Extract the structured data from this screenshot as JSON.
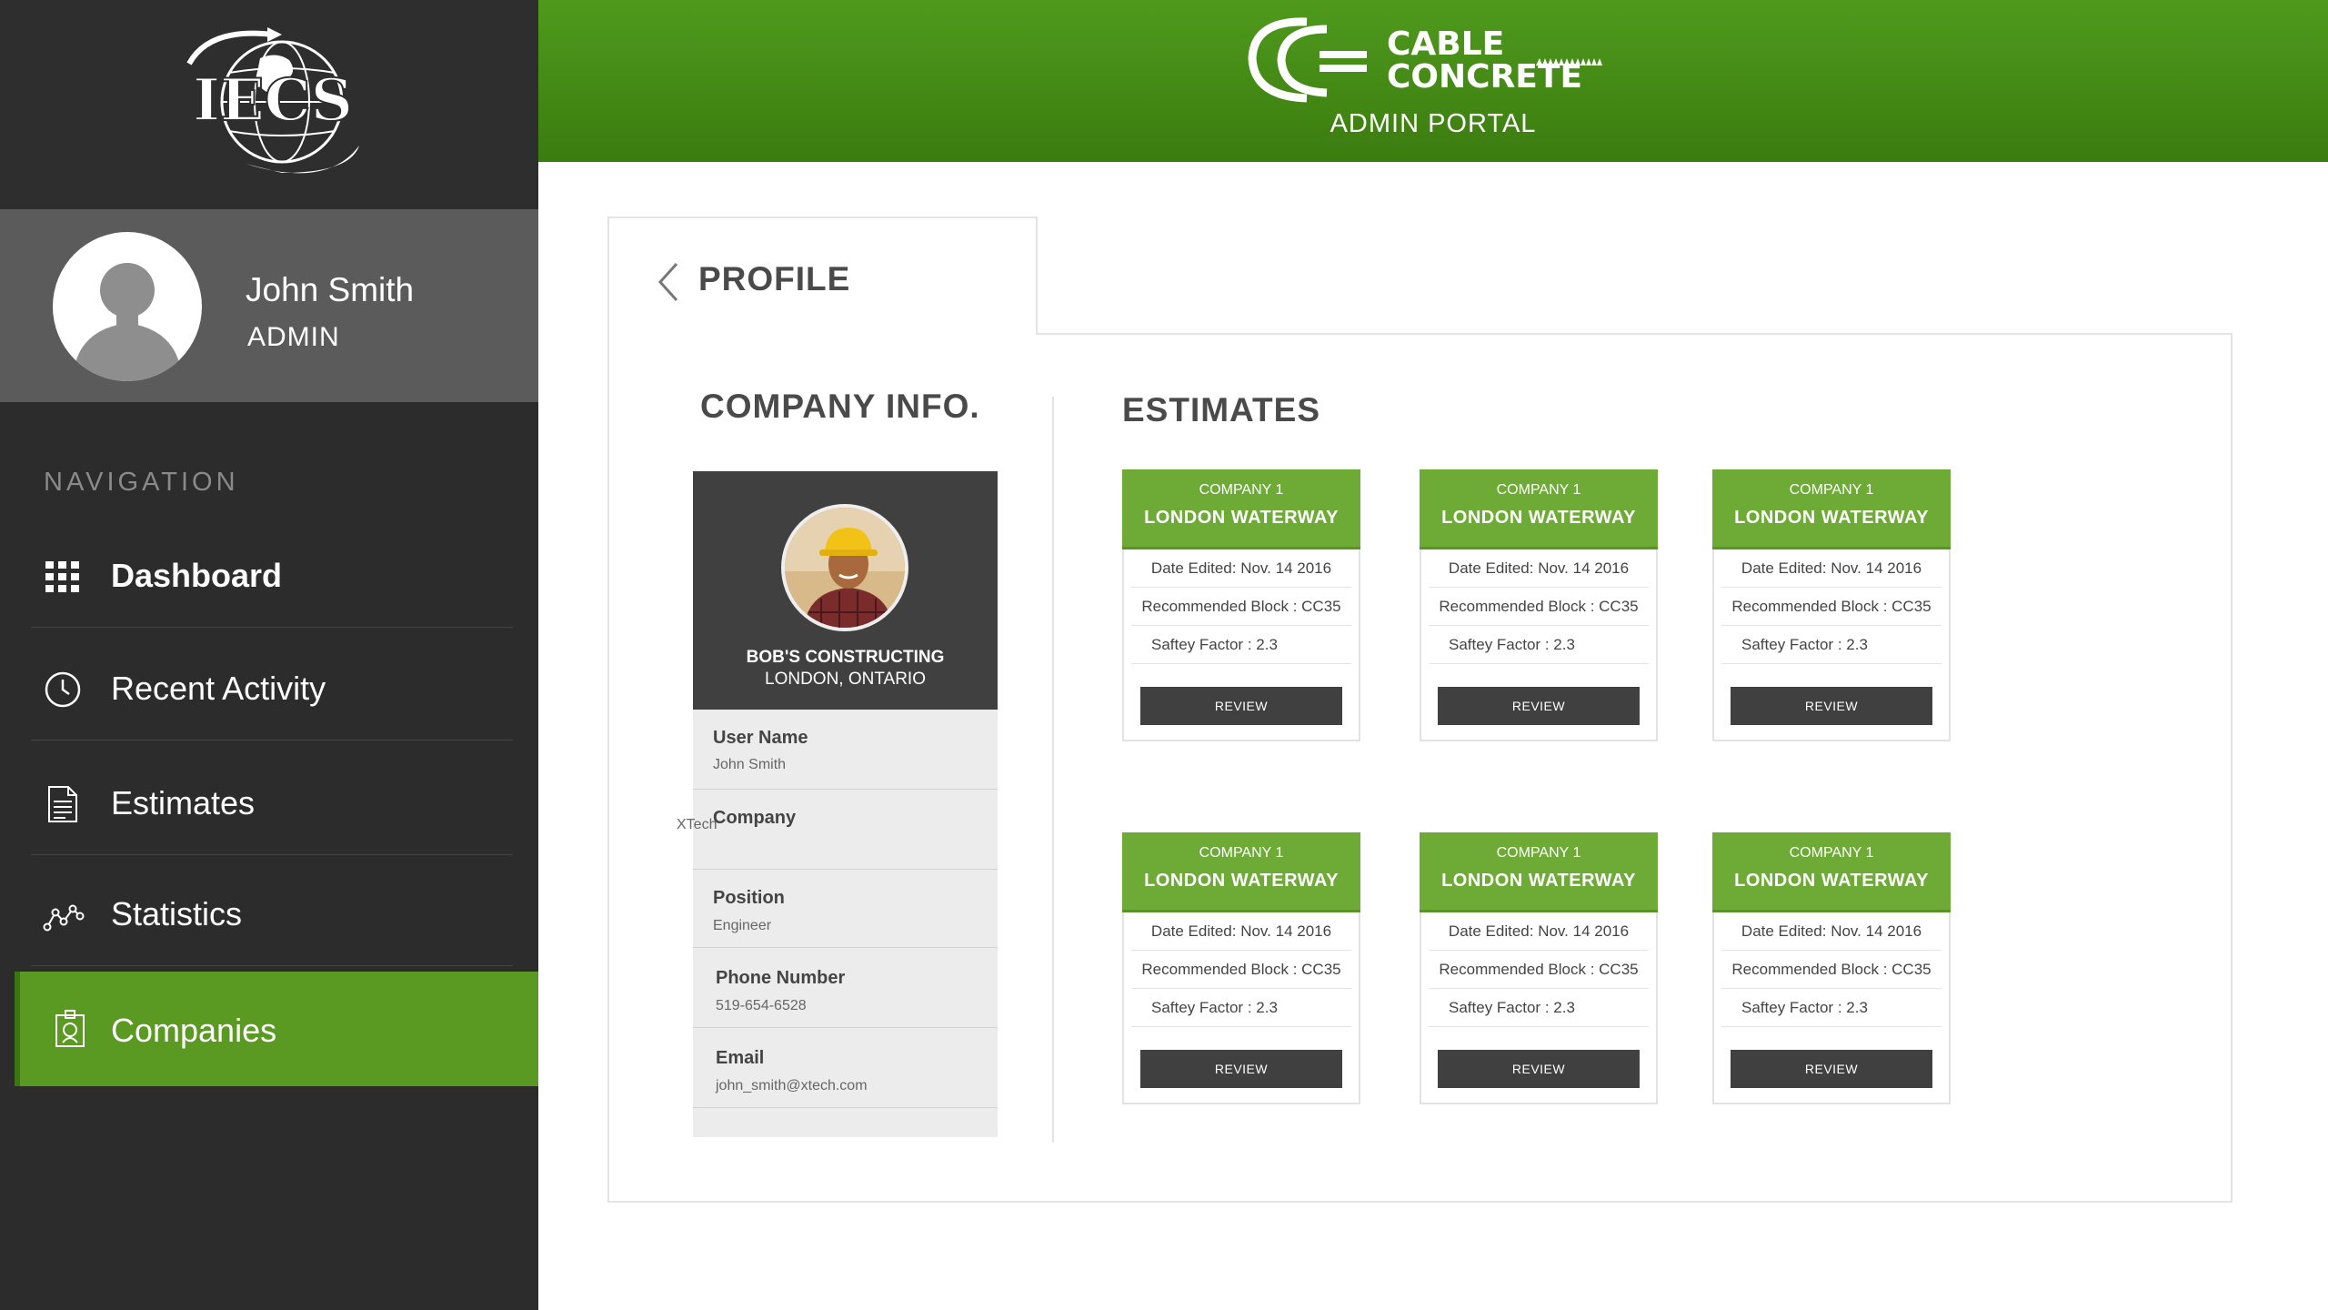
{
  "sidebar": {
    "logo_text": "IECS",
    "user": {
      "name": "John Smith",
      "role": "ADMIN"
    },
    "nav_heading": "NAVIGATION",
    "items": [
      {
        "label": "Dashboard",
        "icon": "grid-icon",
        "active": false
      },
      {
        "label": "Recent Activity",
        "icon": "clock-icon",
        "active": false
      },
      {
        "label": "Estimates",
        "icon": "document-icon",
        "active": false
      },
      {
        "label": "Statistics",
        "icon": "line-graph-icon",
        "active": false
      },
      {
        "label": "Companies",
        "icon": "id-badge-icon",
        "active": true
      }
    ]
  },
  "header": {
    "logo_line1": "CABLE",
    "logo_line2": "CONCRETE",
    "portal_title": "ADMIN PORTAL"
  },
  "profile": {
    "tab_title": "PROFILE",
    "company_heading": "COMPANY INFO.",
    "company": {
      "name": "BOB'S CONSTRUCTING",
      "city": "LONDON, ONTARIO",
      "fields": [
        {
          "label": "User Name",
          "value": "John Smith"
        },
        {
          "label": "Company",
          "value": "XTech"
        },
        {
          "label": "Position",
          "value": "Engineer"
        },
        {
          "label": "Phone Number",
          "value": "519-654-6528"
        },
        {
          "label": "Email",
          "value": "john_smith@xtech.com"
        }
      ]
    }
  },
  "estimates": {
    "heading": "ESTIMATES",
    "cards": [
      {
        "company": "COMPANY 1",
        "title": "LONDON WATERWAY",
        "date": "Date Edited: Nov. 14 2016",
        "block": "Recommended Block : CC35",
        "safety": "Saftey Factor : 2.3",
        "button": "REVIEW"
      },
      {
        "company": "COMPANY 1",
        "title": "LONDON WATERWAY",
        "date": "Date Edited: Nov. 14 2016",
        "block": "Recommended Block : CC35",
        "safety": "Saftey Factor : 2.3",
        "button": "REVIEW"
      },
      {
        "company": "COMPANY 1",
        "title": "LONDON WATERWAY",
        "date": "Date Edited: Nov. 14 2016",
        "block": "Recommended Block : CC35",
        "safety": "Saftey Factor : 2.3",
        "button": "REVIEW"
      },
      {
        "company": "COMPANY 1",
        "title": "LONDON WATERWAY",
        "date": "Date Edited: Nov. 14 2016",
        "block": "Recommended Block : CC35",
        "safety": "Saftey Factor : 2.3",
        "button": "REVIEW"
      },
      {
        "company": "COMPANY 1",
        "title": "LONDON WATERWAY",
        "date": "Date Edited: Nov. 14 2016",
        "block": "Recommended Block : CC35",
        "safety": "Saftey Factor : 2.3",
        "button": "REVIEW"
      },
      {
        "company": "COMPANY 1",
        "title": "LONDON WATERWAY",
        "date": "Date Edited: Nov. 14 2016",
        "block": "Recommended Block : CC35",
        "safety": "Saftey Factor : 2.3",
        "button": "REVIEW"
      }
    ]
  },
  "colors": {
    "accent_green": "#5a9a22",
    "header_green": "#4f9a1d",
    "sidebar_dark": "#2c2c2c",
    "card_green": "#6eaa36"
  }
}
